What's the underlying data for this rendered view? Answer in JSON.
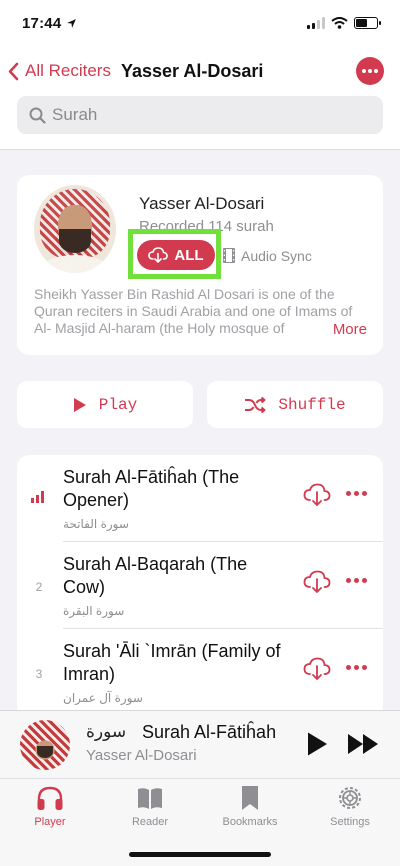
{
  "status": {
    "time": "17:44"
  },
  "nav": {
    "back_label": "All Reciters",
    "title": "Yasser Al-Dosari",
    "search_placeholder": "Surah"
  },
  "reciter": {
    "name": "Yasser Al-Dosari",
    "recorded": "Recorded 114 surah",
    "download_all_label": "ALL",
    "audio_sync_label": "Audio Sync",
    "description": "Sheikh Yasser Bin Rashid Al Dosari is one of the Quran reciters in Saudi Arabia and one of Imams of Al- Masjid Al-haram (the Holy mosque of",
    "more_label": "More"
  },
  "actions": {
    "play_label": "Play",
    "shuffle_label": "Shuffle"
  },
  "surahs": [
    {
      "number": "",
      "playing": true,
      "title": "Surah Al-Fātiĥah (The Opener)",
      "arabic": "سورة الفاتحة"
    },
    {
      "number": "2",
      "playing": false,
      "title": "Surah Al-Baqarah (The Cow)",
      "arabic": "سورة البقرة"
    },
    {
      "number": "3",
      "playing": false,
      "title": "Surah 'Āli `Imrān (Family of Imran)",
      "arabic": "سورة آل عمران"
    }
  ],
  "mini_player": {
    "arabic": "سورة",
    "title": "Surah Al-Fātiĥah",
    "reciter": "Yasser Al-Dosari"
  },
  "tabs": [
    {
      "label": "Player",
      "icon": "headphones-icon",
      "active": true
    },
    {
      "label": "Reader",
      "icon": "book-icon",
      "active": false
    },
    {
      "label": "Bookmarks",
      "icon": "bookmark-icon",
      "active": false
    },
    {
      "label": "Settings",
      "icon": "gear-icon",
      "active": false
    }
  ],
  "colors": {
    "accent": "#d23a4f",
    "highlight": "#72e03a"
  }
}
